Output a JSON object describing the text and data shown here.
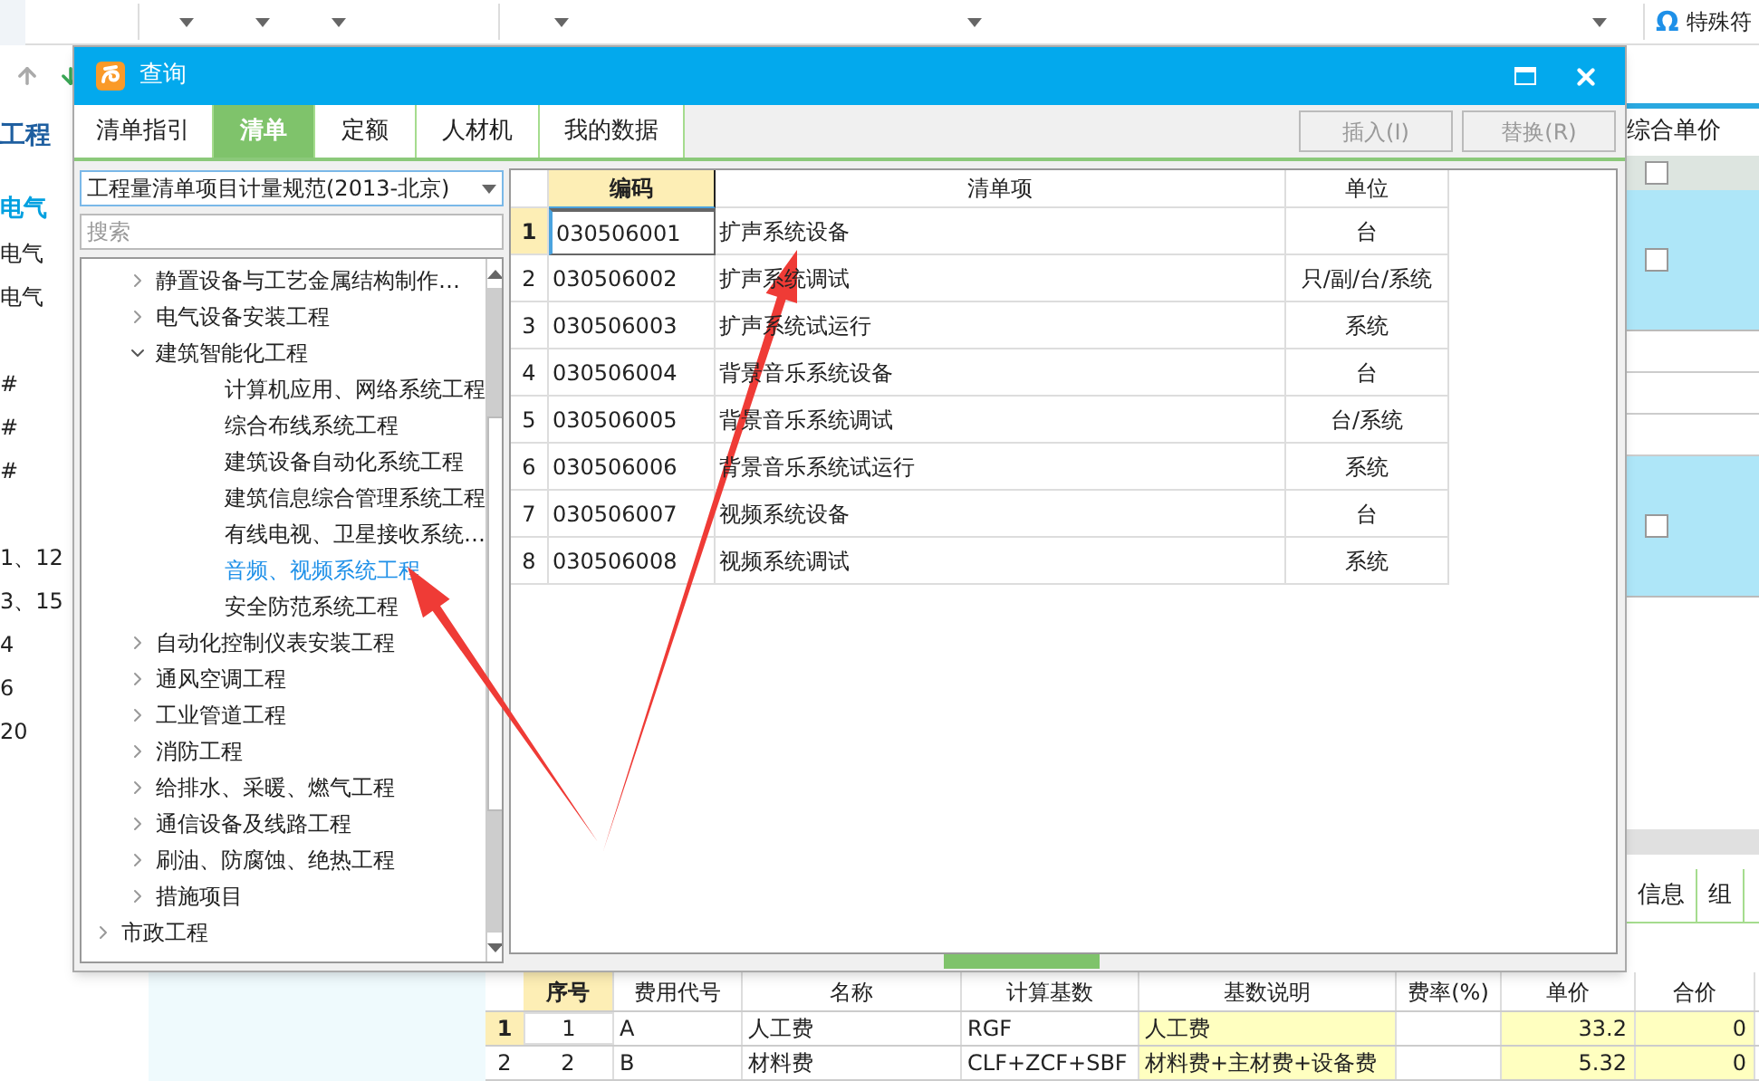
{
  "toolbar": {
    "symbol_icon": "Ω",
    "symbol_label": "特殊符"
  },
  "left_pane": {
    "title": "工程",
    "groups": [
      [
        {
          "label": "电气",
          "selected": true
        },
        {
          "label": "电气",
          "selected": false
        },
        {
          "label": "电气",
          "selected": false
        }
      ],
      [
        {
          "label": "#",
          "selected": false
        },
        {
          "label": "#",
          "selected": false
        },
        {
          "label": "#",
          "selected": false
        }
      ],
      [
        {
          "label": "1、12",
          "selected": false
        },
        {
          "label": "3、15",
          "selected": false
        },
        {
          "label": "4",
          "selected": false
        },
        {
          "label": "6",
          "selected": false
        },
        {
          "label": "20",
          "selected": false
        }
      ]
    ]
  },
  "right_pane": {
    "header": "综合单价",
    "rows": [
      {
        "kind": "filter",
        "checked": false
      },
      {
        "kind": "record",
        "checked": false
      },
      {
        "kind": "detail"
      },
      {
        "kind": "detail"
      },
      {
        "kind": "detail"
      },
      {
        "kind": "record",
        "checked": false
      }
    ],
    "tabs": [
      "信息",
      "组"
    ]
  },
  "fee_table": {
    "columns": [
      "序号",
      "费用代号",
      "名称",
      "计算基数",
      "基数说明",
      "费率(%)",
      "单价",
      "合价"
    ],
    "rows": [
      {
        "number": "1",
        "selected": true,
        "seq": "1",
        "code": "A",
        "name": "人工费",
        "base": "RGF",
        "base_desc": "人工费",
        "unit_price": "33.2",
        "total": "0"
      },
      {
        "number": "2",
        "selected": false,
        "seq": "2",
        "code": "B",
        "name": "材料费",
        "base": "CLF+ZCF+SBF",
        "base_desc": "材料费+主材费+设备费",
        "unit_price": "5.32",
        "total": "0"
      }
    ]
  },
  "dialog": {
    "title": "查询",
    "tabs": [
      {
        "label": "清单指引",
        "selected": false
      },
      {
        "label": "清单",
        "selected": true
      },
      {
        "label": "定额",
        "selected": false
      },
      {
        "label": "人材机",
        "selected": false
      },
      {
        "label": "我的数据",
        "selected": false
      }
    ],
    "buttons": [
      {
        "label": "插入(I)",
        "disabled": true
      },
      {
        "label": "替换(R)",
        "disabled": true
      }
    ],
    "standard": {
      "value": "工程量清单项目计量规范(2013-北京)"
    },
    "search": {
      "placeholder": "搜索"
    },
    "tree": [
      {
        "children": [
          {
            "label": "静置设备与工艺金属结构制作…",
            "expanded": false,
            "selected": false
          },
          {
            "label": "电气设备安装工程",
            "expanded": false,
            "selected": false
          },
          {
            "label": "建筑智能化工程",
            "expanded": true,
            "selected": false,
            "children": [
              {
                "label": "计算机应用、网络系统工程",
                "selected": false
              },
              {
                "label": "综合布线系统工程",
                "selected": false
              },
              {
                "label": "建筑设备自动化系统工程",
                "selected": false
              },
              {
                "label": "建筑信息综合管理系统工程",
                "selected": false
              },
              {
                "label": "有线电视、卫星接收系统…",
                "selected": false
              },
              {
                "label": "音频、视频系统工程",
                "selected": true
              },
              {
                "label": "安全防范系统工程",
                "selected": false
              }
            ]
          },
          {
            "label": "自动化控制仪表安装工程",
            "expanded": false,
            "selected": false
          },
          {
            "label": "通风空调工程",
            "expanded": false,
            "selected": false
          },
          {
            "label": "工业管道工程",
            "expanded": false,
            "selected": false
          },
          {
            "label": "消防工程",
            "expanded": false,
            "selected": false
          },
          {
            "label": "给排水、采暖、燃气工程",
            "expanded": false,
            "selected": false
          },
          {
            "label": "通信设备及线路工程",
            "expanded": false,
            "selected": false
          },
          {
            "label": "刷油、防腐蚀、绝热工程",
            "expanded": false,
            "selected": false
          },
          {
            "label": "措施项目",
            "expanded": false,
            "selected": false
          }
        ]
      },
      {
        "label": "市政工程",
        "expanded": false,
        "selected": false
      }
    ],
    "table": {
      "columns": [
        {
          "label": "编码",
          "highlighted": true
        },
        {
          "label": "清单项",
          "highlighted": false
        },
        {
          "label": "单位",
          "highlighted": false
        }
      ],
      "rows": [
        {
          "number": "1",
          "selected": true,
          "code": "030506001",
          "name": "扩声系统设备",
          "unit": "台"
        },
        {
          "number": "2",
          "selected": false,
          "code": "030506002",
          "name": "扩声系统调试",
          "unit": "只/副/台/系统"
        },
        {
          "number": "3",
          "selected": false,
          "code": "030506003",
          "name": "扩声系统试运行",
          "unit": "系统"
        },
        {
          "number": "4",
          "selected": false,
          "code": "030506004",
          "name": "背景音乐系统设备",
          "unit": "台"
        },
        {
          "number": "5",
          "selected": false,
          "code": "030506005",
          "name": "背景音乐系统调试",
          "unit": "台/系统"
        },
        {
          "number": "6",
          "selected": false,
          "code": "030506006",
          "name": "背景音乐系统试运行",
          "unit": "系统"
        },
        {
          "number": "7",
          "selected": false,
          "code": "030506007",
          "name": "视频系统设备",
          "unit": "台"
        },
        {
          "number": "8",
          "selected": false,
          "code": "030506008",
          "name": "视频系统调试",
          "unit": "系统"
        }
      ]
    }
  }
}
